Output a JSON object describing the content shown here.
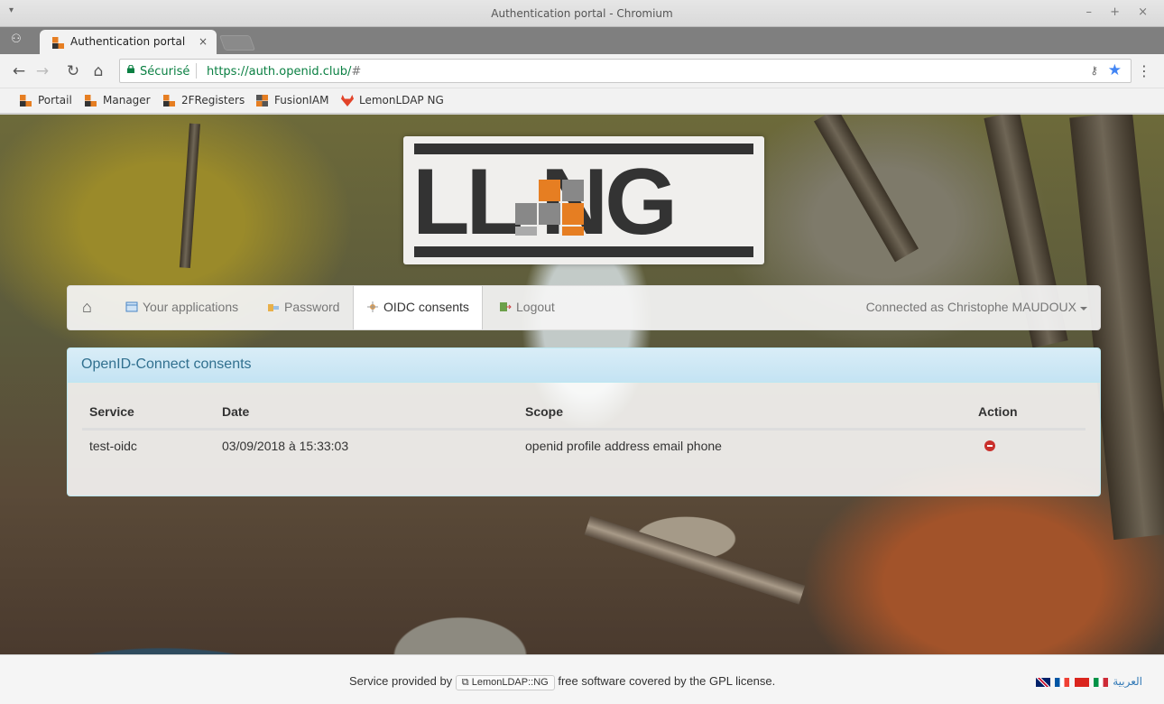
{
  "window": {
    "title": "Authentication portal - Chromium",
    "controls": "– + ×"
  },
  "tab": {
    "label": "Authentication portal",
    "close": "×"
  },
  "omnibox": {
    "secure_label": "Sécurisé",
    "url_host": "https://auth.openid.club/",
    "url_rest": "#"
  },
  "bookmarks": [
    {
      "label": "Portail"
    },
    {
      "label": "Manager"
    },
    {
      "label": "2FRegisters"
    },
    {
      "label": "FusionIAM"
    },
    {
      "label": "LemonLDAP NG"
    }
  ],
  "logo": {
    "text": "LL  NG",
    "colors": {
      "dark": "#333333",
      "orange": "#e67e22",
      "grey": "#888888"
    }
  },
  "nav": {
    "applications": "Your applications",
    "password": "Password",
    "oidc": "OIDC consents",
    "logout": "Logout",
    "user": "Connected as Christophe MAUDOUX"
  },
  "panel": {
    "title": "OpenID-Connect consents",
    "columns": [
      "Service",
      "Date",
      "Scope",
      "Action"
    ],
    "rows": [
      {
        "service": "test-oidc",
        "date": "03/09/2018 à 15:33:03",
        "scope": "openid profile address email phone",
        "action": "delete-icon"
      }
    ]
  },
  "footer": {
    "prefix": "Service provided by",
    "link": "LemonLDAP::NG",
    "suffix": "free software covered by the GPL license.",
    "arabic": "العربية"
  },
  "colors": {
    "accent": "#31708f",
    "panel_head": "#d9edf7",
    "danger": "#c9302c",
    "secure": "#0b8043",
    "star": "#4285f4"
  }
}
